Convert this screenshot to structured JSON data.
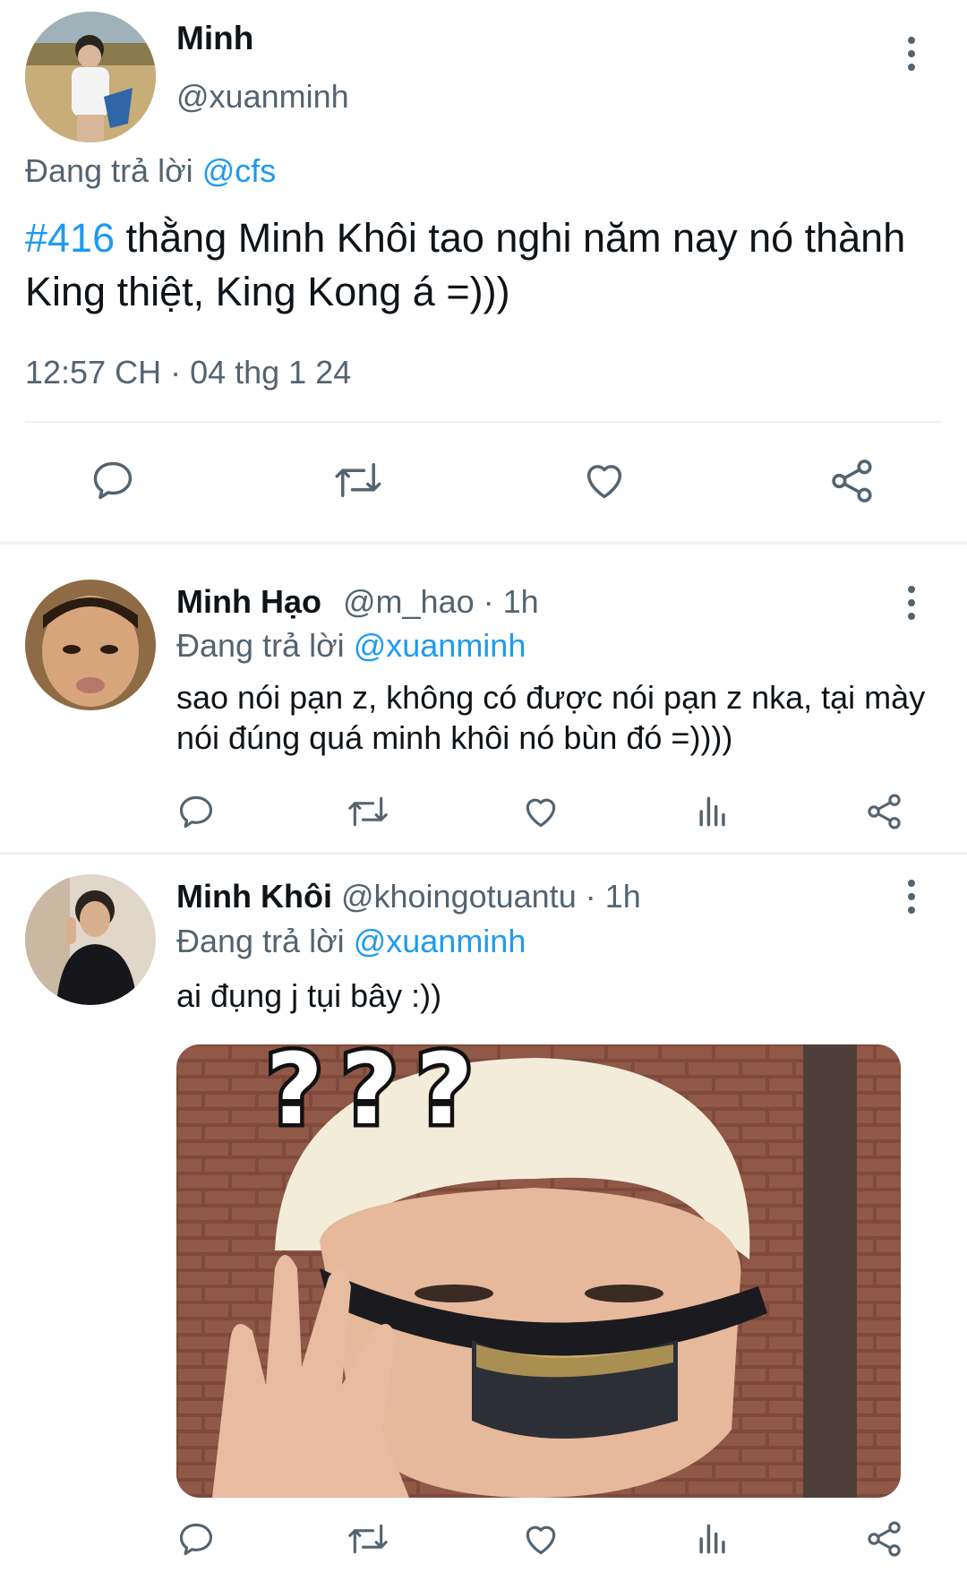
{
  "main_tweet": {
    "display_name": "Minh",
    "handle": "@xuanminh",
    "reply_prefix": "Đang trả lời",
    "reply_to": "@cfs",
    "hashtag": "#416",
    "text": " thằng Minh Khôi tao nghi năm nay nó thành King thiệt, King Kong á =)))",
    "timestamp": "12:57 CH · 04 thg 1 24",
    "actions": [
      "reply-icon",
      "retweet-icon",
      "like-icon",
      "share-icon"
    ]
  },
  "replies": [
    {
      "display_name": "Minh Hạo",
      "handle": "@m_hao",
      "time": "· 1h",
      "reply_prefix": "Đang trả lời",
      "reply_to": "@xuanminh",
      "text": "sao nói pạn z, không có được nói pạn z nka, tại mày nói đúng quá minh khôi nó bùn đó =))))"
    },
    {
      "display_name": "Minh Khôi",
      "handle": "@khoingotuantu",
      "time": "· 1h",
      "reply_prefix": "Đang trả lời",
      "reply_to": "@xuanminh",
      "text": "ai đụng j tụi bây :))",
      "media_caption": "???"
    }
  ],
  "colors": {
    "link": "#1d9bf0",
    "muted": "#536471",
    "divider": "#eff3f4"
  }
}
